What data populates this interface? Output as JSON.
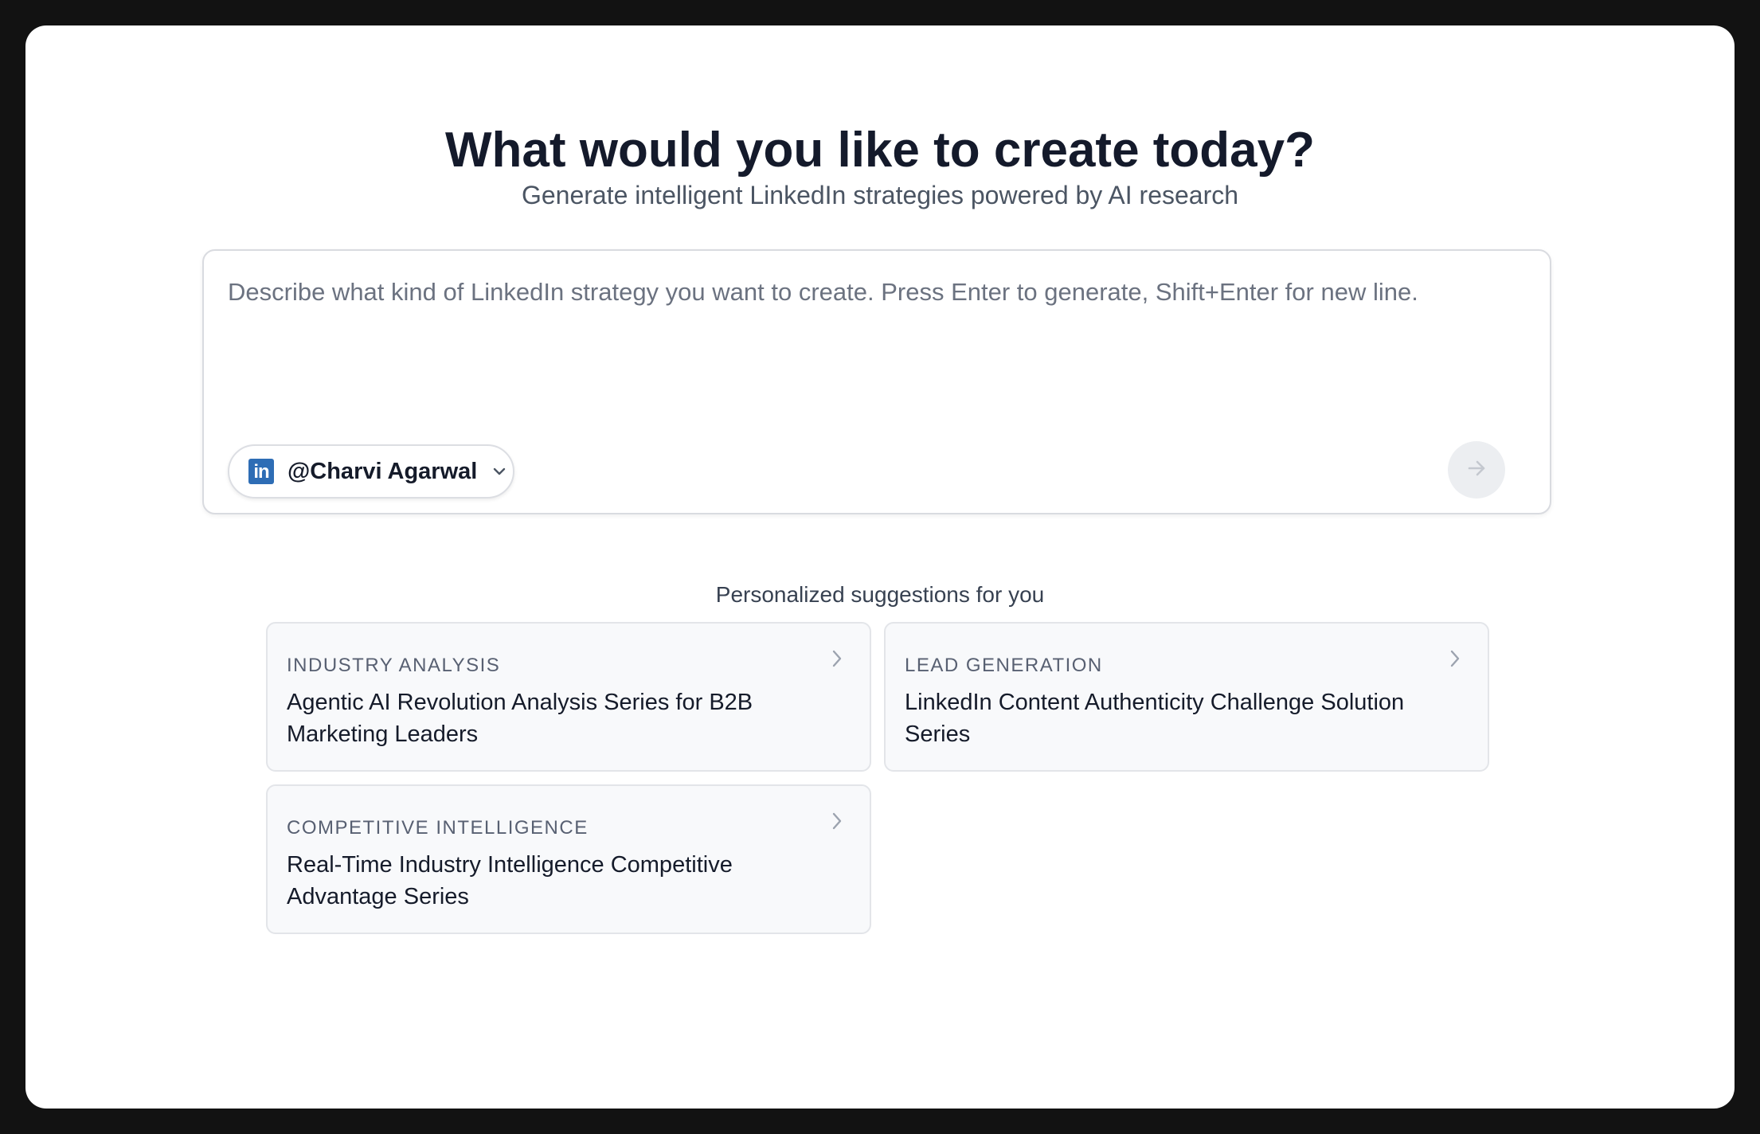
{
  "header": {
    "title": "What would you like to create today?",
    "subtitle": "Generate intelligent LinkedIn strategies powered by AI research"
  },
  "composer": {
    "placeholder": "Describe what kind of LinkedIn strategy you want to create. Press Enter to generate, Shift+Enter for new line.",
    "value": "",
    "account": {
      "icon": "linkedin-icon",
      "icon_text": "in",
      "name": "@Charvi Agarwal"
    },
    "send_icon": "arrow-right-icon"
  },
  "suggestions": {
    "heading": "Personalized suggestions for you",
    "items": [
      {
        "category": "INDUSTRY ANALYSIS",
        "title": "Agentic AI Revolution Analysis Series for B2B Marketing Leaders"
      },
      {
        "category": "LEAD GENERATION",
        "title": "LinkedIn Content Authenticity Challenge Solution Series"
      },
      {
        "category": "COMPETITIVE INTELLIGENCE",
        "title": "Real-Time Industry Intelligence Competitive Advantage Series"
      }
    ]
  },
  "colors": {
    "page_background": "#121212",
    "window_background": "#ffffff",
    "title_text": "#141a2b",
    "linkedin_blue": "#2e6db5",
    "card_background": "#f8f9fb"
  }
}
